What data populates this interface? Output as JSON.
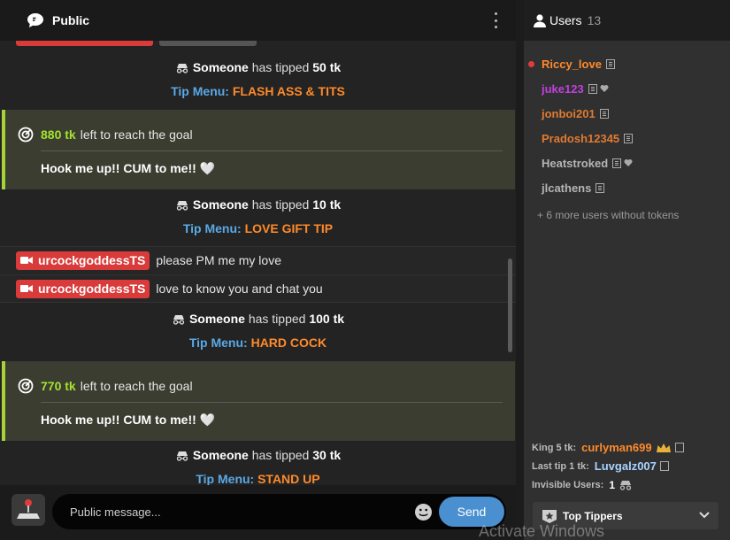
{
  "header": {
    "title": "Public"
  },
  "messages": {
    "tips": [
      {
        "user": "Someone",
        "verb": "has tipped",
        "amount": "50 tk",
        "menu_label": "Tip Menu:",
        "menu_item": "FLASH ASS & TITS"
      },
      {
        "user": "Someone",
        "verb": "has tipped",
        "amount": "10 tk",
        "menu_label": "Tip Menu:",
        "menu_item": "LOVE GIFT TIP"
      },
      {
        "user": "Someone",
        "verb": "has tipped",
        "amount": "100 tk",
        "menu_label": "Tip Menu:",
        "menu_item": "HARD COCK"
      },
      {
        "user": "Someone",
        "verb": "has tipped",
        "amount": "30 tk",
        "menu_label": "Tip Menu:",
        "menu_item": "STAND UP"
      }
    ],
    "goals": [
      {
        "amount": "880 tk",
        "text": "left to reach the goal",
        "goal": "Hook me up!! CUM to me!! 🤍"
      },
      {
        "amount": "770 tk",
        "text": "left to reach the goal",
        "goal": "Hook me up!! CUM to me!! 🤍"
      }
    ],
    "chat": [
      {
        "user": "urcockgoddessTS",
        "text": "please PM me my love"
      },
      {
        "user": "urcockgoddessTS",
        "text": "love to know you and chat you"
      }
    ]
  },
  "input": {
    "placeholder": "Public message...",
    "send_label": "Send"
  },
  "users": {
    "title": "Users",
    "count": "13",
    "list": [
      {
        "name": "Riccy_love",
        "color": "#ff8a2a",
        "online_dot": true,
        "heart": false
      },
      {
        "name": "juke123",
        "color": "#c040e0",
        "online_dot": false,
        "heart": true
      },
      {
        "name": "jonboi201",
        "color": "#e07a30",
        "online_dot": false,
        "heart": false
      },
      {
        "name": "Pradosh12345",
        "color": "#e07a30",
        "online_dot": false,
        "heart": false
      },
      {
        "name": "Heatstroked",
        "color": "#b5b5b5",
        "online_dot": false,
        "heart": true
      },
      {
        "name": "jlcathens",
        "color": "#b5b5b5",
        "online_dot": false,
        "heart": false
      }
    ],
    "more": "+ 6 more users without tokens",
    "king_label": "King 5 tk:",
    "king_name": "curlyman699",
    "last_label": "Last tip 1 tk:",
    "last_name": "Luvgalz007",
    "invisible_label": "Invisible Users:",
    "invisible_count": "1",
    "top_tippers": "Top Tippers"
  },
  "watermark": "Activate Windows"
}
